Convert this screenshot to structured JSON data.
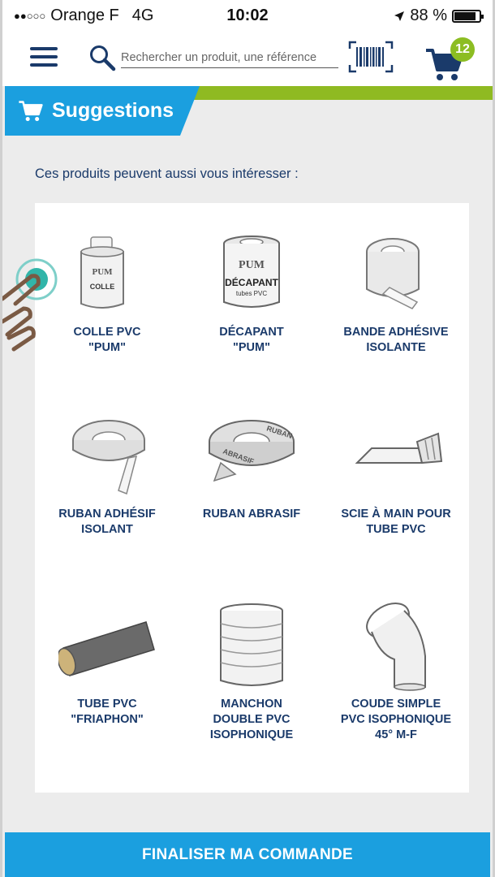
{
  "status_bar": {
    "carrier": "Orange F",
    "network": "4G",
    "time": "10:02",
    "battery": "88 %",
    "battery_level": 0.88
  },
  "header": {
    "search_placeholder": "Rechercher un produit, une référence",
    "cart_count": "12",
    "icons": [
      "menu-icon",
      "search-icon",
      "barcode-icon",
      "cart-icon"
    ]
  },
  "section": {
    "title": "Suggestions",
    "intro": "Ces produits peuvent aussi vous intéresser :"
  },
  "products": [
    {
      "name": "COLLE PVC\n\"PUM\"",
      "label_text": "PUM COLLE"
    },
    {
      "name": "DÉCAPANT\n\"PUM\"",
      "label_text": "PUM DÉCAPANT tubes PVC"
    },
    {
      "name": "BANDE ADHÉSIVE\nISOLANTE"
    },
    {
      "name": "RUBAN ADHÉSIF\nISOLANT"
    },
    {
      "name": "RUBAN ABRASIF",
      "label_text": "RUBAN ABRASIF"
    },
    {
      "name": "SCIE À MAIN POUR\nTUBE PVC"
    },
    {
      "name": "TUBE PVC\n\"FRIAPHON\""
    },
    {
      "name": "MANCHON\nDOUBLE PVC\nISOPHONIQUE"
    },
    {
      "name": "COUDE SIMPLE\nPVC ISOPHONIQUE\n45° M-F"
    }
  ],
  "footer": {
    "finalize_label": "FINALISER MA COMMANDE"
  },
  "colors": {
    "primary_blue": "#1b9fdf",
    "navy": "#1a3a6a",
    "accent_green": "#8fba22",
    "badge_green": "#8cbd22"
  }
}
